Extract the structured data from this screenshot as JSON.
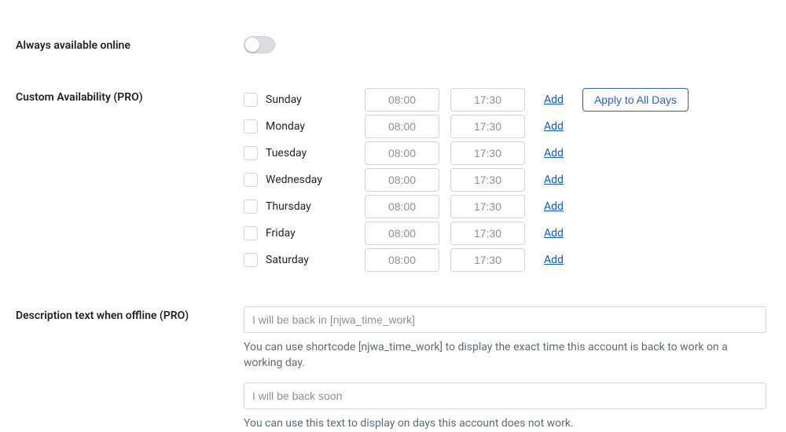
{
  "sections": {
    "always_available": {
      "label": "Always available online",
      "value": false
    },
    "custom_availability": {
      "label": "Custom Availability (PRO)",
      "apply_all": "Apply to All Days",
      "add_label": "Add",
      "days": [
        {
          "name": "Sunday",
          "start": "08:00",
          "end": "17:30"
        },
        {
          "name": "Monday",
          "start": "08:00",
          "end": "17:30"
        },
        {
          "name": "Tuesday",
          "start": "08:00",
          "end": "17:30"
        },
        {
          "name": "Wednesday",
          "start": "08:00",
          "end": "17:30"
        },
        {
          "name": "Thursday",
          "start": "08:00",
          "end": "17:30"
        },
        {
          "name": "Friday",
          "start": "08:00",
          "end": "17:30"
        },
        {
          "name": "Saturday",
          "start": "08:00",
          "end": "17:30"
        }
      ]
    },
    "offline_desc": {
      "label": "Description text when offline (PRO)",
      "input1_placeholder": "I will be back in [njwa_time_work]",
      "help1": "You can use shortcode [njwa_time_work] to display the exact time this account is back to work on a working day.",
      "input2_placeholder": "I will be back soon",
      "help2": "You can use this text to display on days this account does not work."
    }
  }
}
